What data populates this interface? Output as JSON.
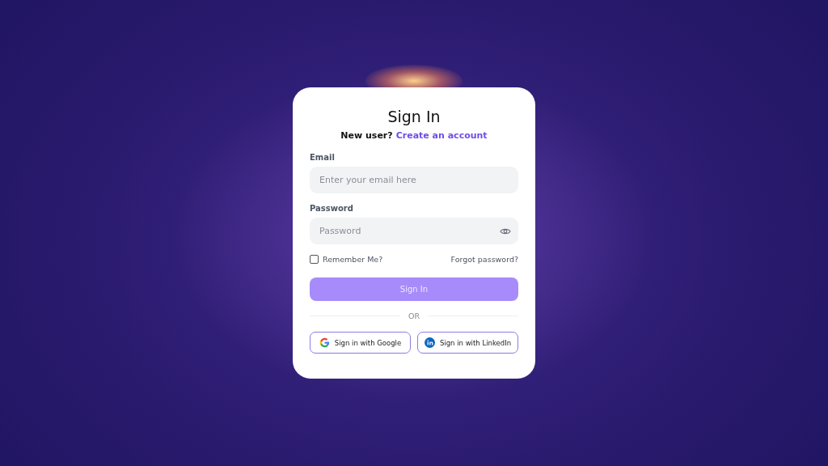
{
  "title": "Sign In",
  "subtitle": {
    "text": "New user?",
    "link": "Create an account"
  },
  "fields": [
    {
      "label": "Email",
      "placeholder": "Enter your email here",
      "kind": "text"
    },
    {
      "label": "Password",
      "placeholder": "Password",
      "kind": "password"
    }
  ],
  "remember": {
    "label": "Remember Me?",
    "checked": false
  },
  "forgot_link": "Forgot password?",
  "submit": {
    "label": "Sign In",
    "disabled": true
  },
  "divider": "OR",
  "social": [
    {
      "label": "Sign in with Google",
      "kind": "google"
    },
    {
      "label": "Sign in with LinkedIn",
      "kind": "linkedin"
    }
  ]
}
